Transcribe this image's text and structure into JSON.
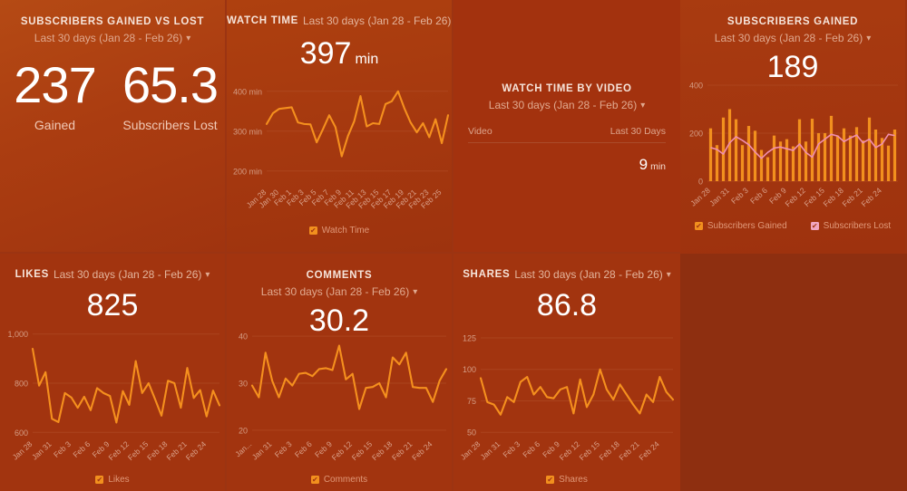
{
  "theme": {
    "page_bg": "#A33610",
    "panel_border": "#9C3412",
    "accent_orange": "#F2901E",
    "accent_pink": "#F2A5C0",
    "title_color": "#F6E4DA",
    "subtitle_color": "#E0A98F",
    "value_color": "#FFFFFF"
  },
  "date_range_label": "Last 30 days (Jan 28 - Feb 26)",
  "chevron_icon": "chevron-down-icon",
  "panels": {
    "subscribers_gained_vs_lost": {
      "title": "SUBSCRIBERS GAINED VS LOST",
      "date_range": "Last 30 days (Jan 28 - Feb 26)",
      "gained_value": "237",
      "gained_label": "Gained",
      "lost_value": "65.3",
      "lost_label": "Subscribers Lost"
    },
    "watch_time": {
      "title": "WATCH TIME",
      "date_range": "Last 30 days (Jan 28 - Feb 26)",
      "value": "397",
      "unit": "min",
      "legend": [
        {
          "label": "Watch Time",
          "color": "#F2901E",
          "checked": true
        }
      ]
    },
    "watch_time_by_video": {
      "title": "WATCH TIME BY VIDEO",
      "date_range": "Last 30 days (Jan 28 - Feb 26)",
      "col_video": "Video",
      "col_period": "Last 30 Days",
      "row_value": "9",
      "row_unit": "min"
    },
    "subscribers_gained": {
      "title": "SUBSCRIBERS GAINED",
      "date_range": "Last 30 days (Jan 28 - Feb 26)",
      "value": "189",
      "legend": [
        {
          "label": "Subscribers Gained",
          "color": "#F2901E",
          "checked": true
        },
        {
          "label": "Subscribers Lost",
          "color": "#F2A5C0",
          "checked": true
        }
      ]
    },
    "likes": {
      "title": "LIKES",
      "date_range": "Last 30 days (Jan 28 - Feb 26)",
      "value": "825",
      "legend": [
        {
          "label": "Likes",
          "color": "#F2901E",
          "checked": true
        }
      ]
    },
    "comments": {
      "title": "COMMENTS",
      "date_range": "Last 30 days (Jan 28 - Feb 26)",
      "value": "30.2",
      "legend": [
        {
          "label": "Comments",
          "color": "#F2901E",
          "checked": true
        }
      ]
    },
    "shares": {
      "title": "SHARES",
      "date_range": "Last 30 days (Jan 28 - Feb 26)",
      "value": "86.8",
      "legend": [
        {
          "label": "Shares",
          "color": "#F2901E",
          "checked": true
        }
      ]
    }
  },
  "chart_data": [
    {
      "id": "watch_time",
      "type": "line",
      "title": "WATCH TIME",
      "ylabel": "",
      "xlabel": "",
      "ylim": [
        170,
        420
      ],
      "yticks": [
        200,
        300,
        400
      ],
      "ytick_labels": [
        "200 min",
        "300 min",
        "400 min"
      ],
      "grid": true,
      "legend_position": "bottom",
      "x": [
        "Jan 28",
        "Jan 29",
        "Jan 30",
        "Jan 31",
        "Feb 1",
        "Feb 2",
        "Feb 3",
        "Feb 4",
        "Feb 5",
        "Feb 6",
        "Feb 7",
        "Feb 8",
        "Feb 9",
        "Feb 10",
        "Feb 11",
        "Feb 12",
        "Feb 13",
        "Feb 14",
        "Feb 15",
        "Feb 16",
        "Feb 17",
        "Feb 18",
        "Feb 19",
        "Feb 20",
        "Feb 21",
        "Feb 22",
        "Feb 23",
        "Feb 24",
        "Feb 25",
        "Feb 26"
      ],
      "xtick_labels": [
        "Jan 28",
        "Jan 30",
        "Feb 1",
        "Feb 3",
        "Feb 5",
        "Feb 7",
        "Feb 9",
        "Feb 11",
        "Feb 13",
        "Feb 15",
        "Feb 17",
        "Feb 19",
        "Feb 21",
        "Feb 23",
        "Feb 25"
      ],
      "series": [
        {
          "name": "Watch Time",
          "color": "#F2901E",
          "values": [
            318,
            345,
            356,
            358,
            360,
            322,
            318,
            317,
            272,
            305,
            340,
            310,
            237,
            288,
            325,
            388,
            312,
            320,
            318,
            368,
            375,
            400,
            358,
            322,
            297,
            320,
            285,
            330,
            270,
            340
          ]
        }
      ]
    },
    {
      "id": "subscribers_gained",
      "type": "bar",
      "title": "SUBSCRIBERS GAINED",
      "ylim": [
        0,
        430
      ],
      "yticks": [
        0,
        200,
        400
      ],
      "ytick_labels": [
        "0",
        "200",
        "400"
      ],
      "grid": true,
      "legend_position": "bottom",
      "categories": [
        "Jan 28",
        "Jan 29",
        "Jan 30",
        "Jan 31",
        "Feb 1",
        "Feb 2",
        "Feb 3",
        "Feb 4",
        "Feb 5",
        "Feb 6",
        "Feb 7",
        "Feb 8",
        "Feb 9",
        "Feb 10",
        "Feb 11",
        "Feb 12",
        "Feb 13",
        "Feb 14",
        "Feb 15",
        "Feb 16",
        "Feb 17",
        "Feb 18",
        "Feb 19",
        "Feb 20",
        "Feb 21",
        "Feb 22",
        "Feb 23",
        "Feb 24",
        "Feb 25",
        "Feb 26"
      ],
      "xtick_labels": [
        "Jan 28",
        "Jan 31",
        "Feb 3",
        "Feb 6",
        "Feb 9",
        "Feb 12",
        "Feb 15",
        "Feb 18",
        "Feb 21",
        "Feb 24"
      ],
      "series": [
        {
          "name": "Subscribers Gained",
          "type": "bar",
          "color": "#F2901E",
          "values": [
            220,
            150,
            265,
            300,
            258,
            150,
            230,
            210,
            130,
            100,
            190,
            165,
            175,
            145,
            258,
            165,
            260,
            200,
            200,
            272,
            190,
            220,
            190,
            225,
            170,
            265,
            215,
            180,
            148,
            215
          ]
        },
        {
          "name": "Subscribers Lost",
          "type": "line",
          "color": "#F2A5C0",
          "values": [
            140,
            132,
            113,
            160,
            185,
            170,
            152,
            122,
            95,
            120,
            138,
            142,
            135,
            128,
            155,
            120,
            100,
            155,
            175,
            195,
            188,
            165,
            180,
            192,
            160,
            175,
            140,
            155,
            195,
            190
          ]
        }
      ]
    },
    {
      "id": "likes",
      "type": "line",
      "title": "LIKES",
      "ylim": [
        590,
        1010
      ],
      "yticks": [
        600,
        800,
        1000
      ],
      "ytick_labels": [
        "600",
        "800",
        "1,000"
      ],
      "grid": true,
      "legend_position": "bottom",
      "x": [
        "Jan 28",
        "Jan 29",
        "Jan 30",
        "Jan 31",
        "Feb 1",
        "Feb 2",
        "Feb 3",
        "Feb 4",
        "Feb 5",
        "Feb 6",
        "Feb 7",
        "Feb 8",
        "Feb 9",
        "Feb 10",
        "Feb 11",
        "Feb 12",
        "Feb 13",
        "Feb 14",
        "Feb 15",
        "Feb 16",
        "Feb 17",
        "Feb 18",
        "Feb 19",
        "Feb 20",
        "Feb 21",
        "Feb 22",
        "Feb 23",
        "Feb 24",
        "Feb 25",
        "Feb 26"
      ],
      "xtick_labels": [
        "Jan 28",
        "Jan 31",
        "Feb 3",
        "Feb 6",
        "Feb 9",
        "Feb 12",
        "Feb 15",
        "Feb 18",
        "Feb 21",
        "Feb 24"
      ],
      "series": [
        {
          "name": "Likes",
          "color": "#F2901E",
          "values": [
            940,
            790,
            845,
            655,
            642,
            760,
            742,
            700,
            745,
            690,
            780,
            760,
            748,
            640,
            768,
            712,
            890,
            760,
            800,
            735,
            668,
            810,
            800,
            700,
            862,
            740,
            772,
            665,
            770,
            710
          ]
        }
      ]
    },
    {
      "id": "comments",
      "type": "line",
      "title": "COMMENTS",
      "ylim": [
        19,
        41
      ],
      "yticks": [
        20,
        30,
        40
      ],
      "ytick_labels": [
        "20",
        "30",
        "40"
      ],
      "grid": true,
      "legend_position": "bottom",
      "x": [
        "Jan 28",
        "Jan 29",
        "Jan 30",
        "Jan 31",
        "Feb 1",
        "Feb 2",
        "Feb 3",
        "Feb 4",
        "Feb 5",
        "Feb 6",
        "Feb 7",
        "Feb 8",
        "Feb 9",
        "Feb 10",
        "Feb 11",
        "Feb 12",
        "Feb 13",
        "Feb 14",
        "Feb 15",
        "Feb 16",
        "Feb 17",
        "Feb 18",
        "Feb 19",
        "Feb 20",
        "Feb 21",
        "Feb 22",
        "Feb 23",
        "Feb 24",
        "Feb 25",
        "Feb 26"
      ],
      "xtick_labels": [
        "Jan...",
        "Jan 31",
        "Feb 3",
        "Feb 6",
        "Feb 9",
        "Feb 12",
        "Feb 15",
        "Feb 18",
        "Feb 21",
        "Feb 24"
      ],
      "series": [
        {
          "name": "Comments",
          "color": "#F2901E",
          "values": [
            29.5,
            27.0,
            36.5,
            30.5,
            27.0,
            31.0,
            29.5,
            32.0,
            32.2,
            31.5,
            33.0,
            33.2,
            32.8,
            38.0,
            30.8,
            32.0,
            24.5,
            29.0,
            29.2,
            30.0,
            27.0,
            35.5,
            34.0,
            36.5,
            29.2,
            29.0,
            29.0,
            26.0,
            30.5,
            33.0
          ]
        }
      ]
    },
    {
      "id": "shares",
      "type": "line",
      "title": "SHARES",
      "ylim": [
        48,
        130
      ],
      "yticks": [
        50,
        75,
        100,
        125
      ],
      "ytick_labels": [
        "50",
        "75",
        "100",
        "125"
      ],
      "grid": true,
      "legend_position": "bottom",
      "x": [
        "Jan 28",
        "Jan 29",
        "Jan 30",
        "Jan 31",
        "Feb 1",
        "Feb 2",
        "Feb 3",
        "Feb 4",
        "Feb 5",
        "Feb 6",
        "Feb 7",
        "Feb 8",
        "Feb 9",
        "Feb 10",
        "Feb 11",
        "Feb 12",
        "Feb 13",
        "Feb 14",
        "Feb 15",
        "Feb 16",
        "Feb 17",
        "Feb 18",
        "Feb 19",
        "Feb 20",
        "Feb 21",
        "Feb 22",
        "Feb 23",
        "Feb 24",
        "Feb 25",
        "Feb 26"
      ],
      "xtick_labels": [
        "Jan 28",
        "Jan 31",
        "Feb 3",
        "Feb 6",
        "Feb 9",
        "Feb 12",
        "Feb 15",
        "Feb 18",
        "Feb 21",
        "Feb 24"
      ],
      "series": [
        {
          "name": "Shares",
          "color": "#F2901E",
          "values": [
            93,
            74,
            72,
            64,
            78,
            74,
            90,
            94,
            80,
            86,
            78,
            77,
            84,
            86,
            65,
            92,
            70,
            80,
            100,
            84,
            76,
            88,
            80,
            72,
            65,
            80,
            74,
            94,
            82,
            76
          ]
        }
      ]
    }
  ]
}
